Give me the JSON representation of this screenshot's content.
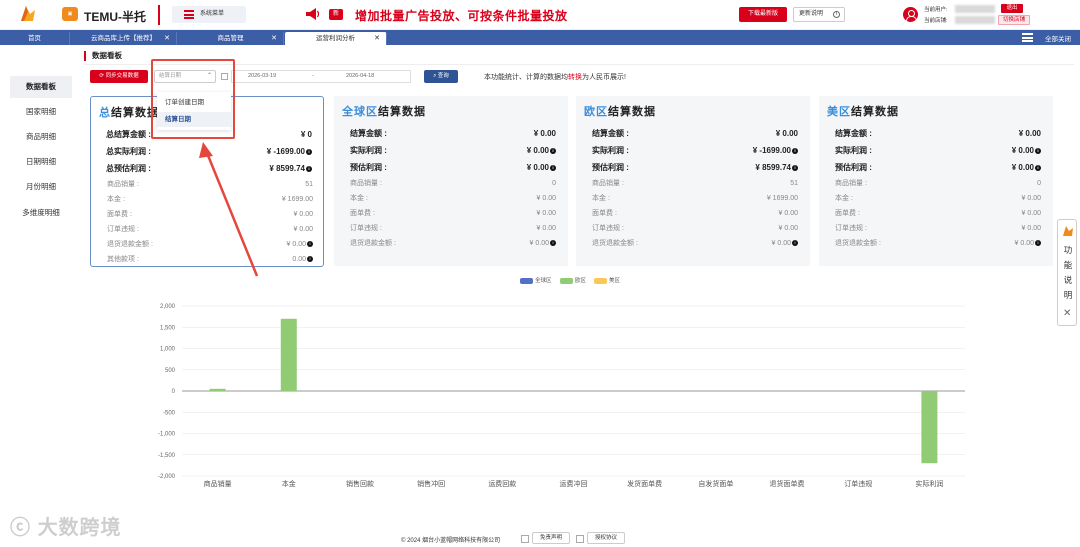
{
  "header": {
    "brand": "TEMU-半托",
    "logo2_text": "\u0000",
    "system_menu": "系统菜单",
    "new_badge": "新",
    "promo": "增加批量广告投放、可按条件批量投放",
    "download_btn": "下载最新版",
    "update_btn": "更新说明",
    "current_user_label": "当前用户:",
    "current_shop_label": "当前店铺:",
    "logout_btn": "退出",
    "switch_shop_btn": "切换店铺"
  },
  "tabs": [
    {
      "label": "首页",
      "closable": false
    },
    {
      "label": "云商品库上传【推荐】",
      "closable": true
    },
    {
      "label": "商品管理",
      "closable": true
    },
    {
      "label": "运营利润分析",
      "closable": true,
      "active": true
    }
  ],
  "close_all": "全部关闭",
  "sidebar": {
    "items": [
      {
        "label": "数据看板",
        "active": true
      },
      {
        "label": "国家明细"
      },
      {
        "label": "商品明细"
      },
      {
        "label": "日期明细"
      },
      {
        "label": "月份明细"
      },
      {
        "label": "多维度明细"
      }
    ]
  },
  "main": {
    "section_title": "数据看板",
    "sync_btn": "同步交易数据",
    "date_select_placeholder": "结算日期",
    "date_start": "2026-03-19",
    "date_sep": "-",
    "date_end": "2026-04-18",
    "query_btn": "查询",
    "notice_pre": "本功能统计、计算的数据均",
    "notice_red": "转换",
    "notice_post": "为人民币展示!",
    "dropdown_options": [
      "订单创建日期",
      "结算日期"
    ],
    "dropdown_selected": "结算日期"
  },
  "cards": [
    {
      "title_pre": "总",
      "title_main": "结算数据",
      "bold_rows": [
        {
          "label": "总结算金额 :",
          "value": "¥ 0",
          "info": false
        },
        {
          "label": "总实际利润 :",
          "value": "¥ -1699.00",
          "info": true
        },
        {
          "label": "总预估利润 :",
          "value": "¥ 8599.74",
          "info": true
        }
      ],
      "rows": [
        {
          "label": "商品销量 :",
          "value": "51",
          "info": false
        },
        {
          "label": "本金 :",
          "value": "¥ 1699.00",
          "info": false
        },
        {
          "label": "面单费 :",
          "value": "¥ 0.00",
          "info": false
        },
        {
          "label": "订单违规 :",
          "value": "¥ 0.00",
          "info": false
        },
        {
          "label": "退货退款金额 :",
          "value": "¥ 0.00",
          "info": true
        },
        {
          "label": "其他款项 :",
          "value": "0.00",
          "info": true
        }
      ]
    },
    {
      "title_pre": "全球区",
      "title_main": "结算数据",
      "bold_rows": [
        {
          "label": "结算金额 :",
          "value": "¥ 0.00",
          "info": false
        },
        {
          "label": "实际利润 :",
          "value": "¥ 0.00",
          "info": true
        },
        {
          "label": "预估利润 :",
          "value": "¥ 0.00",
          "info": true
        }
      ],
      "rows": [
        {
          "label": "商品销量 :",
          "value": "0",
          "info": false
        },
        {
          "label": "本金 :",
          "value": "¥ 0.00",
          "info": false
        },
        {
          "label": "面单费 :",
          "value": "¥ 0.00",
          "info": false
        },
        {
          "label": "订单违规 :",
          "value": "¥ 0.00",
          "info": false
        },
        {
          "label": "退货退款金额 :",
          "value": "¥ 0.00",
          "info": true
        }
      ]
    },
    {
      "title_pre": "欧区",
      "title_main": "结算数据",
      "bold_rows": [
        {
          "label": "结算金额 :",
          "value": "¥ 0.00",
          "info": false
        },
        {
          "label": "实际利润 :",
          "value": "¥ -1699.00",
          "info": true
        },
        {
          "label": "预估利润 :",
          "value": "¥ 8599.74",
          "info": true
        }
      ],
      "rows": [
        {
          "label": "商品销量 :",
          "value": "51",
          "info": false
        },
        {
          "label": "本金 :",
          "value": "¥ 1699.00",
          "info": false
        },
        {
          "label": "面单费 :",
          "value": "¥ 0.00",
          "info": false
        },
        {
          "label": "订单违规 :",
          "value": "¥ 0.00",
          "info": false
        },
        {
          "label": "退货退款金额 :",
          "value": "¥ 0.00",
          "info": true
        }
      ]
    },
    {
      "title_pre": "美区",
      "title_main": "结算数据",
      "bold_rows": [
        {
          "label": "结算金额 :",
          "value": "¥ 0.00",
          "info": false
        },
        {
          "label": "实际利润 :",
          "value": "¥ 0.00",
          "info": true
        },
        {
          "label": "预估利润 :",
          "value": "¥ 0.00",
          "info": true
        }
      ],
      "rows": [
        {
          "label": "商品销量 :",
          "value": "0",
          "info": false
        },
        {
          "label": "本金 :",
          "value": "¥ 0.00",
          "info": false
        },
        {
          "label": "面单费 :",
          "value": "¥ 0.00",
          "info": false
        },
        {
          "label": "订单违规 :",
          "value": "¥ 0.00",
          "info": false
        },
        {
          "label": "退货退款金额 :",
          "value": "¥ 0.00",
          "info": true
        }
      ]
    }
  ],
  "chart_data": {
    "type": "bar",
    "categories": [
      "商品销量",
      "本金",
      "销售回款",
      "销售冲回",
      "运费回款",
      "运费冲回",
      "发货面单费",
      "自发货面单",
      "退货面单费",
      "订单违规",
      "实际利润"
    ],
    "series": [
      {
        "name": "全球区",
        "color": "#5470c6",
        "values": [
          0,
          0,
          0,
          0,
          0,
          0,
          0,
          0,
          0,
          0,
          0
        ]
      },
      {
        "name": "欧区",
        "color": "#91cc75",
        "values": [
          51,
          1699,
          0,
          0,
          0,
          0,
          0,
          0,
          0,
          0,
          -1699
        ]
      },
      {
        "name": "美区",
        "color": "#fac858",
        "values": [
          0,
          0,
          0,
          0,
          0,
          0,
          0,
          0,
          0,
          0,
          0
        ]
      }
    ],
    "yticks": [
      2000,
      1500,
      1000,
      500,
      0,
      -500,
      -1000,
      -1500,
      -2000
    ],
    "ytick_labels": [
      "2,000",
      "1,500",
      "1,000",
      "500",
      "0",
      "-500",
      "-1,000",
      "-1,500",
      "-2,000"
    ],
    "ylim": [
      -2000,
      2000
    ],
    "legend_position": "top-center",
    "grid": true
  },
  "func_panel": {
    "text": "功能说明"
  },
  "footer": {
    "copyright": "© 2024 烟台小蓝帽网络科技有限公司",
    "disclaimer_btn": "免责声明",
    "license_btn": "授权协议"
  },
  "watermark": "大数跨境",
  "colors": {
    "brand_red": "#d9001b",
    "tab_blue": "#3b5ea6",
    "query_blue": "#2f5496",
    "title_blue": "#3b8ed8"
  }
}
